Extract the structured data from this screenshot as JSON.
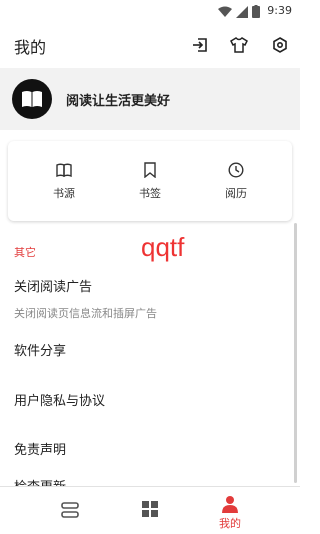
{
  "status_bar": {
    "time": "9:39"
  },
  "app_bar": {
    "title": "我的"
  },
  "profile": {
    "slogan": "阅读让生活更美好"
  },
  "quick_actions": [
    {
      "label": "书源",
      "icon": "book-open-icon"
    },
    {
      "label": "书签",
      "icon": "bookmark-icon"
    },
    {
      "label": "阅历",
      "icon": "clock-icon"
    }
  ],
  "section": {
    "title": "其它"
  },
  "watermark": "qqtf",
  "settings": [
    {
      "label": "关闭阅读广告",
      "subtitle": "关闭阅读页信息流和插屏广告"
    },
    {
      "label": "软件分享"
    },
    {
      "label": "用户隐私与协议"
    },
    {
      "label": "免责声明"
    },
    {
      "label": "检查更新"
    }
  ],
  "bottom_nav": [
    {
      "label": "",
      "icon": "bookshelf-icon",
      "active": false
    },
    {
      "label": "",
      "icon": "grid-icon",
      "active": false
    },
    {
      "label": "我的",
      "icon": "person-icon",
      "active": true
    }
  ],
  "colors": {
    "accent": "#e23b3b",
    "profile_bg": "#f2f2f2"
  }
}
